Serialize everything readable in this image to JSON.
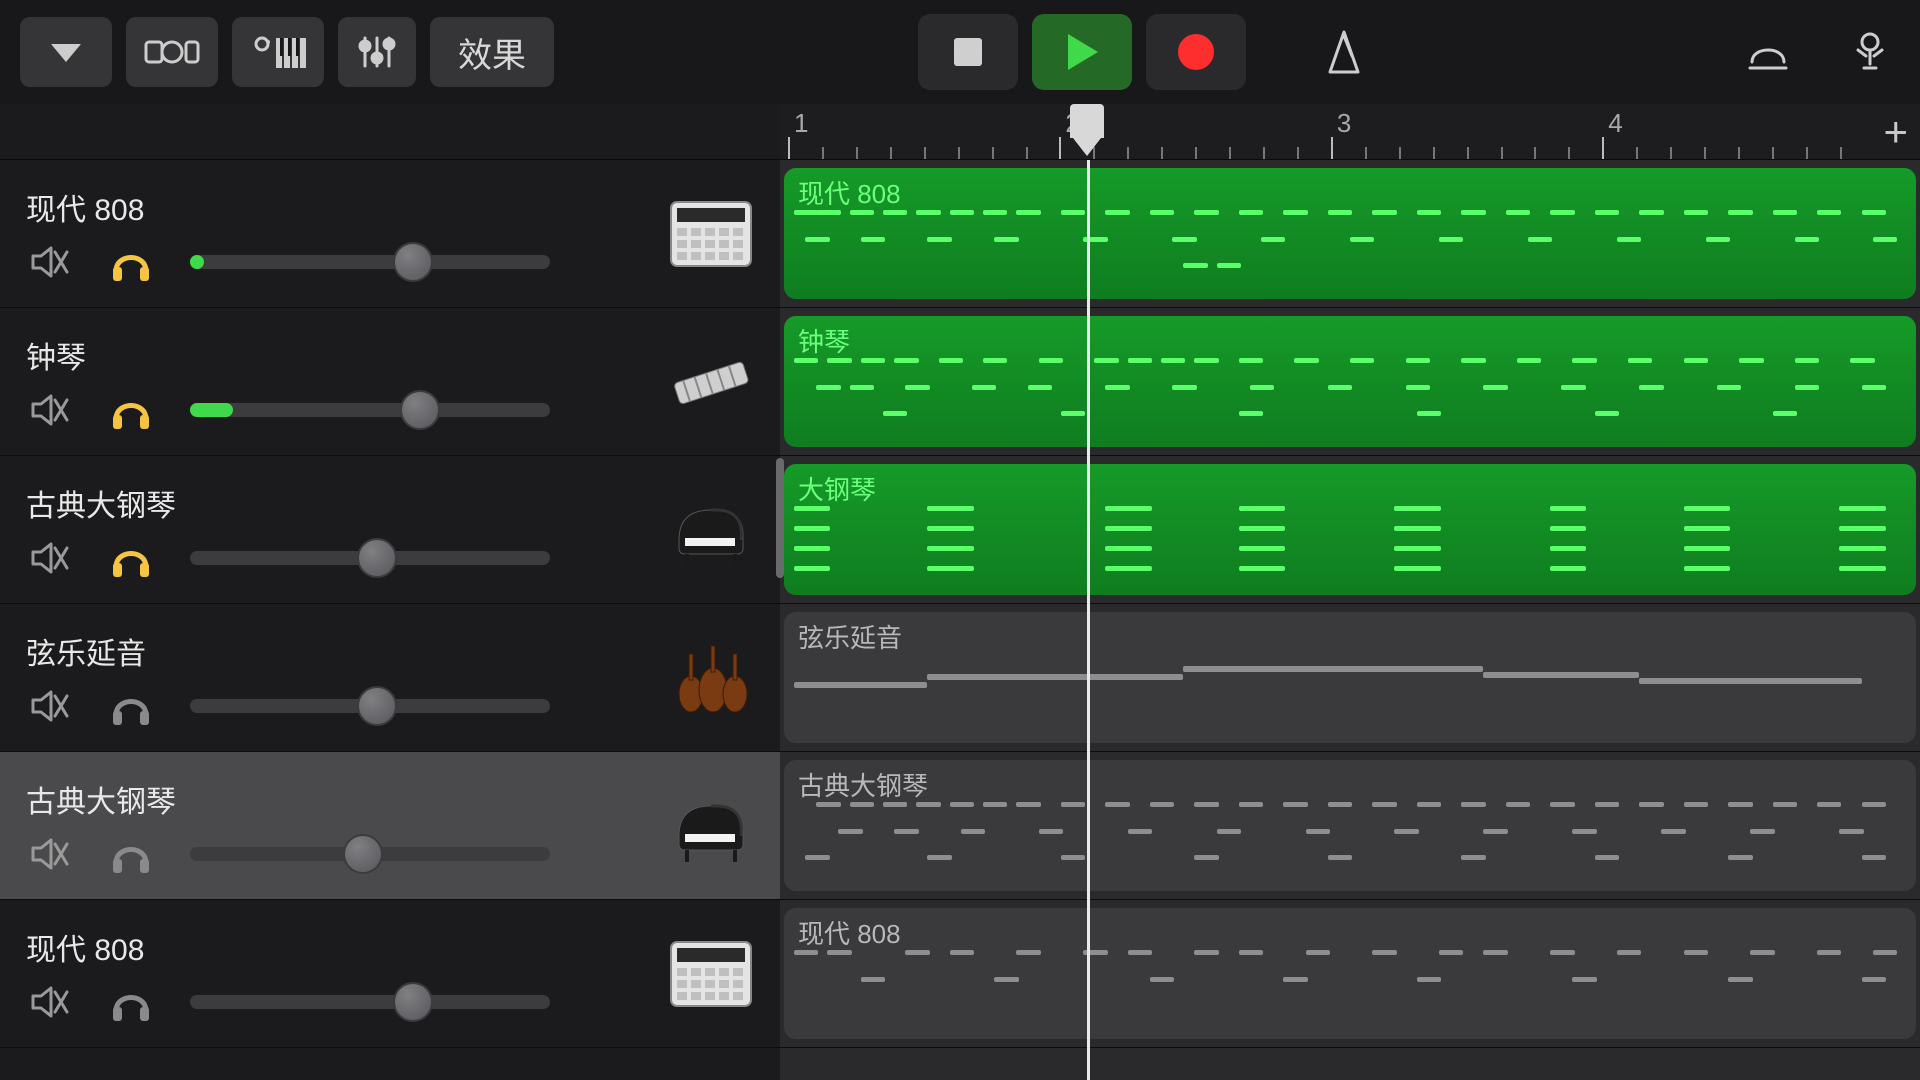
{
  "toolbar": {
    "effects_label": "效果"
  },
  "ruler": {
    "bars": [
      "1",
      "2",
      "3",
      "4"
    ],
    "playhead_bar": 2
  },
  "tracks": [
    {
      "name": "现代 808",
      "region_label": "现代 808",
      "solo_active": true,
      "volume_pct": 62,
      "meter_pct": 4,
      "instrument": "drum-machine",
      "region_style": "green",
      "selected": false,
      "note_rows": [
        [
          0,
          2,
          5,
          8,
          11,
          14,
          17,
          20,
          24,
          28,
          32,
          36,
          40,
          44,
          48,
          52,
          56,
          60,
          64,
          68,
          72,
          76,
          80,
          84,
          88,
          92,
          96
        ],
        [
          1,
          6,
          12,
          18,
          26,
          34,
          42,
          50,
          58,
          66,
          74,
          82,
          90,
          97
        ],
        [
          35,
          38
        ]
      ]
    },
    {
      "name": "钟琴",
      "region_label": "钟琴",
      "solo_active": true,
      "volume_pct": 64,
      "meter_pct": 12,
      "instrument": "glockenspiel",
      "region_style": "green",
      "selected": false,
      "note_rows": [
        [
          0,
          3,
          6,
          9,
          13,
          17,
          22,
          27,
          30,
          33,
          36,
          40,
          45,
          50,
          55,
          60,
          65,
          70,
          75,
          80,
          85,
          90,
          95
        ],
        [
          2,
          5,
          10,
          16,
          21,
          28,
          34,
          41,
          48,
          55,
          62,
          69,
          76,
          83,
          90,
          96
        ],
        [
          8,
          24,
          40,
          56,
          72,
          88
        ]
      ]
    },
    {
      "name": "古典大钢琴",
      "region_label": "大钢琴",
      "solo_active": true,
      "volume_pct": 52,
      "meter_pct": 0,
      "instrument": "grand-piano",
      "region_style": "green",
      "selected": false,
      "note_rows": [
        [
          0,
          1,
          12,
          13,
          14,
          28,
          29,
          30,
          40,
          41,
          42,
          54,
          55,
          56,
          68,
          69,
          80,
          81,
          82,
          94,
          95,
          96
        ],
        [
          0,
          1,
          12,
          13,
          14,
          28,
          29,
          30,
          40,
          41,
          42,
          54,
          55,
          56,
          68,
          69,
          80,
          81,
          82,
          94,
          95,
          96
        ],
        [
          0,
          1,
          12,
          13,
          14,
          28,
          29,
          30,
          40,
          41,
          42,
          54,
          55,
          56,
          68,
          69,
          80,
          81,
          82,
          94,
          95,
          96
        ],
        [
          0,
          1,
          12,
          13,
          14,
          28,
          29,
          30,
          40,
          41,
          42,
          54,
          55,
          56,
          68,
          69,
          80,
          81,
          82,
          94,
          95,
          96
        ]
      ]
    },
    {
      "name": "弦乐延音",
      "region_label": "弦乐延音",
      "solo_active": false,
      "volume_pct": 52,
      "meter_pct": 0,
      "instrument": "strings",
      "region_style": "grey",
      "selected": false,
      "note_rows": [
        [
          0,
          0,
          0,
          0,
          0,
          0,
          0,
          0,
          0,
          0,
          0,
          0,
          12,
          12,
          12,
          12,
          12,
          12,
          12,
          12,
          12,
          35,
          35,
          35,
          35,
          35,
          35,
          35,
          35,
          35,
          35,
          35,
          35,
          35,
          35,
          35,
          35,
          62,
          62,
          62,
          62,
          62,
          62,
          62,
          62,
          62,
          62,
          62,
          62,
          62,
          62,
          62,
          62,
          62
        ]
      ],
      "sustain": true
    },
    {
      "name": "古典大钢琴",
      "region_label": "古典大钢琴",
      "solo_active": false,
      "volume_pct": 48,
      "meter_pct": 0,
      "instrument": "grand-piano",
      "region_style": "grey",
      "selected": true,
      "note_rows": [
        [
          2,
          5,
          8,
          11,
          14,
          17,
          20,
          24,
          28,
          32,
          36,
          40,
          44,
          48,
          52,
          56,
          60,
          64,
          68,
          72,
          76,
          80,
          84,
          88,
          92,
          96
        ],
        [
          4,
          9,
          15,
          22,
          30,
          38,
          46,
          54,
          62,
          70,
          78,
          86,
          94
        ],
        [
          1,
          12,
          24,
          36,
          48,
          60,
          72,
          84,
          96
        ]
      ]
    },
    {
      "name": "现代 808",
      "region_label": "现代 808",
      "solo_active": false,
      "volume_pct": 62,
      "meter_pct": 0,
      "instrument": "drum-machine",
      "region_style": "grey",
      "selected": false,
      "note_rows": [
        [
          0,
          3,
          10,
          14,
          20,
          26,
          30,
          36,
          40,
          46,
          52,
          58,
          62,
          68,
          74,
          80,
          86,
          92,
          97
        ],
        [
          6,
          18,
          32,
          44,
          56,
          70,
          84,
          96
        ]
      ]
    }
  ]
}
